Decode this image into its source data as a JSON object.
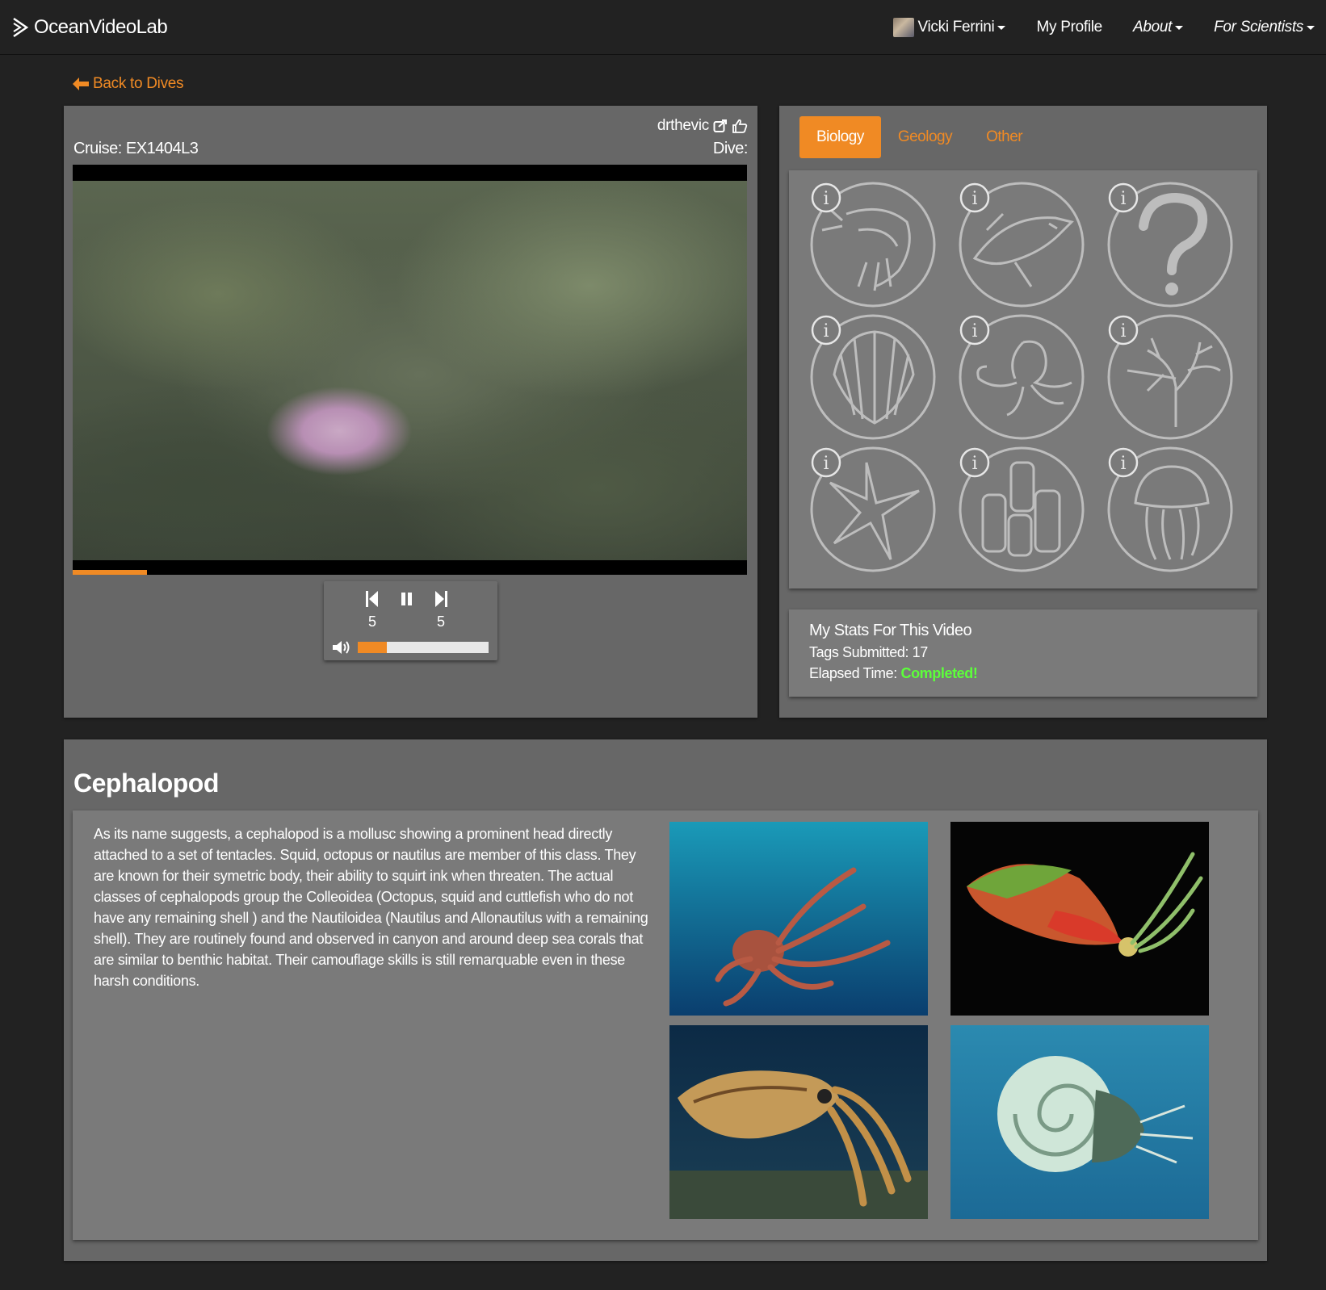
{
  "navbar": {
    "brand": "OceanVideoLab",
    "user_name": "Vicki Ferrini",
    "my_profile": "My Profile",
    "about": "About",
    "for_scientists": "For Scientists"
  },
  "back_link": "Back to Dives",
  "video": {
    "username": "drthevic",
    "cruise_label": "Cruise: EX1404L3",
    "dive_label": "Dive:",
    "progress_fraction": 0.11,
    "skip_back_seconds": "5",
    "skip_forward_seconds": "5",
    "volume_fraction": 0.22
  },
  "tabs": [
    {
      "label": "Biology",
      "active": true
    },
    {
      "label": "Geology",
      "active": false
    },
    {
      "label": "Other",
      "active": false
    }
  ],
  "categories": [
    {
      "icon": "shrimp-icon"
    },
    {
      "icon": "fish-icon"
    },
    {
      "icon": "question-icon"
    },
    {
      "icon": "shell-icon"
    },
    {
      "icon": "octopus-icon"
    },
    {
      "icon": "coral-icon"
    },
    {
      "icon": "starfish-icon"
    },
    {
      "icon": "sponge-icon"
    },
    {
      "icon": "jellyfish-icon"
    }
  ],
  "stats": {
    "title": "My Stats For This Video",
    "tags_submitted": "Tags Submitted: 17",
    "elapsed_label": "Elapsed Time:",
    "elapsed_value": "Completed!"
  },
  "info": {
    "title": "Cephalopod",
    "description": "As its name suggests, a cephalopod is a mollusc showing a prominent head directly attached to a set of tentacles. Squid, octopus or nautilus are member of this class. They are known for their symetric body, their ability to squirt ink when threaten. The actual classes of cephalopods group the Colleoidea (Octopus, squid and cuttlefish who do not have any remaining shell ) and the Nautiloidea (Nautilus and Allonautilus with a remaining shell). They are routinely found and observed in canyon and around deep sea corals that are similar to benthic habitat. Their camouflage skills is still remarquable even in these harsh conditions."
  },
  "colors": {
    "accent": "#f08a24",
    "completed": "#5cff3a",
    "panel": "#676767",
    "inner_panel": "#7a7a7a"
  }
}
